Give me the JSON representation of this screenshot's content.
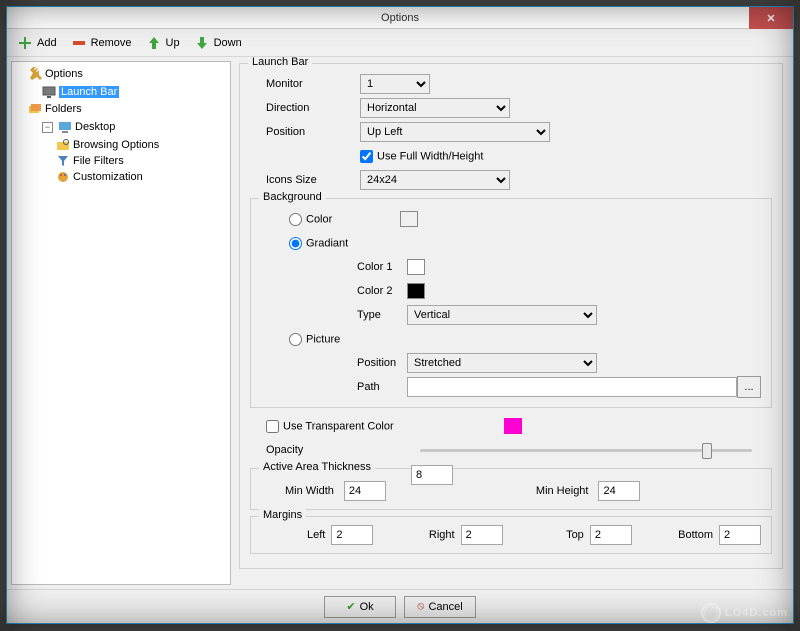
{
  "window": {
    "title": "Options"
  },
  "toolbar": {
    "add": "Add",
    "remove": "Remove",
    "up": "Up",
    "down": "Down"
  },
  "tree": {
    "options": "Options",
    "launch_bar": "Launch Bar",
    "folders": "Folders",
    "desktop": "Desktop",
    "browsing_options": "Browsing Options",
    "file_filters": "File Filters",
    "customization": "Customization"
  },
  "panel": {
    "title": "Launch Bar",
    "monitor_label": "Monitor",
    "monitor_value": "1",
    "direction_label": "Direction",
    "direction_value": "Horizontal",
    "position_label": "Position",
    "position_value": "Up Left",
    "use_full_label": "Use Full Width/Height",
    "use_full_checked": true,
    "icons_size_label": "Icons Size",
    "icons_size_value": "24x24",
    "background": {
      "legend": "Background",
      "color_label": "Color",
      "gradient_label": "Gradiant",
      "color1_label": "Color 1",
      "color2_label": "Color 2",
      "type_label": "Type",
      "type_value": "Vertical",
      "picture_label": "Picture",
      "pic_position_label": "Position",
      "pic_position_value": "Stretched",
      "path_label": "Path",
      "path_value": "",
      "browse_label": "...",
      "color_swatch": "#ffffff",
      "color1_swatch": "#ffffff",
      "color2_swatch": "#000000",
      "selected": "gradient"
    },
    "use_transparent_label": "Use Transparent Color",
    "transparent_swatch": "#ff00d4",
    "opacity_label": "Opacity",
    "opacity_value": 85,
    "active_area": {
      "legend": "Active Area Thickness",
      "value": "8",
      "min_width_label": "Min Width",
      "min_width_value": "24",
      "min_height_label": "Min Height",
      "min_height_value": "24"
    },
    "margins": {
      "legend": "Margins",
      "left_label": "Left",
      "left_value": "2",
      "right_label": "Right",
      "right_value": "2",
      "top_label": "Top",
      "top_value": "2",
      "bottom_label": "Bottom",
      "bottom_value": "2"
    }
  },
  "footer": {
    "ok": "Ok",
    "cancel": "Cancel"
  },
  "watermark": "LO4D.com"
}
